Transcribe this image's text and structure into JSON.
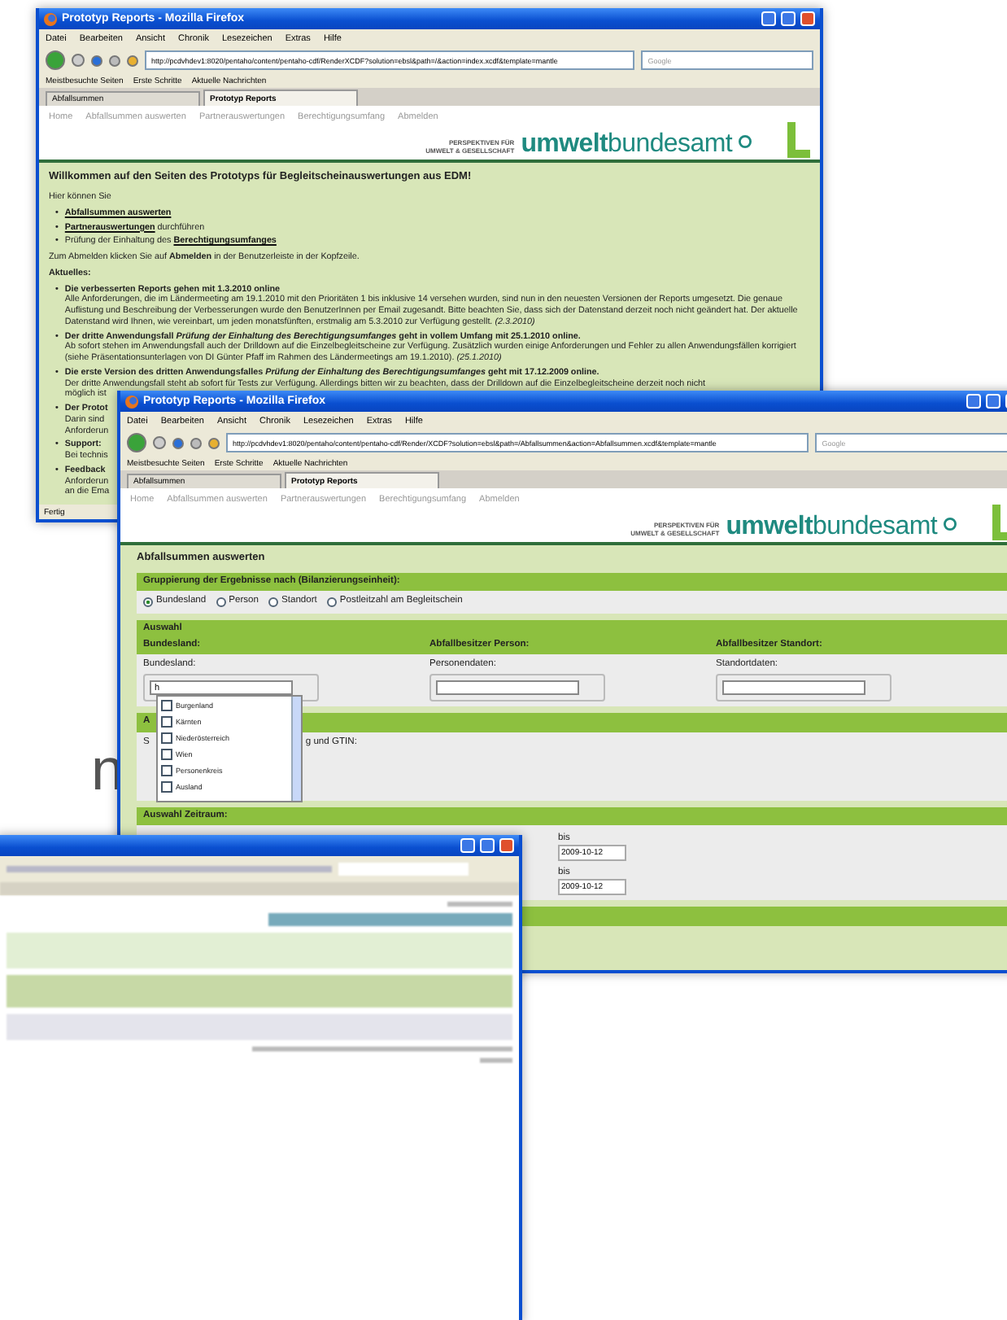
{
  "slide_text": "n",
  "windows": [
    {
      "kind": "welcome",
      "title": "Prototyp Reports - Mozilla Firefox",
      "menu": [
        "Datei",
        "Bearbeiten",
        "Ansicht",
        "Chronik",
        "Lesezeichen",
        "Extras",
        "Hilfe"
      ],
      "url": "http://pcdvhdev1:8020/pentaho/content/pentaho-cdf/RenderXCDF?solution=ebsl&path=/&action=index.xcdf&template=mantle",
      "search_placeholder": "Google",
      "bookmarks": [
        "Meistbesuchte Seiten",
        "Erste Schritte",
        "Aktuelle Nachrichten"
      ],
      "tabs": [
        {
          "label": "Abfallsummen",
          "selected": false
        },
        {
          "label": "Prototyp Reports",
          "selected": true
        }
      ],
      "nav": [
        "Home",
        "Abfallsummen auswerten",
        "Partnerauswertungen",
        "Berechtigungsumfang",
        "Abmelden"
      ],
      "logo": {
        "tagline_1": "PERSPEKTIVEN FÜR",
        "tagline_2": "UMWELT & GESELLSCHAFT",
        "name": "**umwelt**bundesamt"
      },
      "heading": "Willkommen auf den Seiten des Prototyps für Begleitscheinauswertungen aus EDM!",
      "intro": "Hier können Sie",
      "bullet": "•",
      "links": [
        {
          "link": "Abfallsummen auswerten"
        },
        {
          "link": "Partnerauswertungen",
          "rest": " durchführen"
        },
        {
          "link": "Berechtigungsumfanges",
          "before": "Prüfung der Einhaltung des "
        }
      ],
      "logout_hint": "Zum Abmelden klicken Sie auf **Abmelden** in der Benutzerleiste in der Kopfzeile.",
      "news_heading": "Aktuelles:",
      "news": [
        {
          "title": "Die verbesserten Reports gehen mit 1.3.2010 online",
          "body": "Alle Anforderungen, die im Ländermeeting am 19.1.2010 mit den Prioritäten 1 bis inklusive 14 versehen wurden, sind nun in den neuesten Versionen der Reports umgesetzt. Die genaue Auflistung und Beschreibung der Verbesserungen wurde den BenutzerInnen per Email zugesandt. Bitte beachten Sie, dass sich der Datenstand derzeit noch nicht geändert hat. Der aktuelle Datenstand wird Ihnen, wie vereinbart, um jeden monatsfünften, erstmalig am 5.3.2010 zur Verfügung gestellt. *(2.3.2010)*"
        },
        {
          "title": "Der dritte Anwendungsfall *Prüfung der Einhaltung des Berechtigungsumfanges* geht in vollem Umfang mit 25.1.2010 online.",
          "body": "Ab sofort stehen im Anwendungsfall auch der Drilldown auf die Einzelbegleitscheine zur Verfügung. Zusätzlich wurden einige Anforderungen und Fehler zu allen Anwendungsfällen korrigiert (siehe Präsentationsunterlagen von DI Günter Pfaff im Rahmen des Ländermeetings am 19.1.2010). *(25.1.2010)*"
        },
        {
          "title": "Die erste Version des dritten Anwendungsfalles *Prüfung der Einhaltung des Berechtigungsumfanges* geht mit 17.12.2009 online.",
          "body": "Der dritte Anwendungsfall steht ab sofort für Tests zur Verfügung. Allerdings bitten wir zu beachten, dass der Drilldown auf die Einzelbegleitscheine derzeit noch nicht",
          "more": "möglich ist"
        }
      ],
      "fragments": [
        {
          "title": "Der Protot",
          "lines": [
            "Darin sind",
            "Anforderun"
          ]
        },
        {
          "title": "Support:",
          "lines": [
            "Bei technis"
          ]
        },
        {
          "title": "Feedback",
          "lines": [
            "Anforderun",
            "an die Ema"
          ]
        }
      ],
      "status": "Fertig"
    },
    {
      "kind": "form",
      "title": "Prototyp Reports - Mozilla Firefox",
      "menu": [
        "Datei",
        "Bearbeiten",
        "Ansicht",
        "Chronik",
        "Lesezeichen",
        "Extras",
        "Hilfe"
      ],
      "url": "http://pcdvhdev1:8020/pentaho/content/pentaho-cdf/Render/XCDF?solution=ebsl&path=/Abfallsummen&action=Abfallsummen.xcdf&template=mantle",
      "search_placeholder": "Google",
      "bookmarks": [
        "Meistbesuchte Seiten",
        "Erste Schritte",
        "Aktuelle Nachrichten"
      ],
      "tabs": [
        {
          "label": "Abfallsummen",
          "selected": false
        },
        {
          "label": "Prototyp Reports",
          "selected": true
        }
      ],
      "nav": [
        "Home",
        "Abfallsummen auswerten",
        "Partnerauswertungen",
        "Berechtigungsumfang",
        "Abmelden"
      ],
      "logo": {
        "tagline_1": "PERSPEKTIVEN FÜR",
        "tagline_2": "UMWELT & GESELLSCHAFT",
        "name": "**umwelt**bundesamt"
      },
      "page_title": "Abfallsummen auswerten",
      "grouping": {
        "title": "Gruppierung der Ergebnisse nach (Bilanzierungseinheit):",
        "options": [
          {
            "label": "Bundesland",
            "selected": true
          },
          {
            "label": "Person",
            "selected": false
          },
          {
            "label": "Standort",
            "selected": false
          },
          {
            "label": "Postleitzahl am Begleitschein",
            "selected": false
          }
        ]
      },
      "selection": {
        "title": "Auswahl",
        "columns": [
          {
            "heading": "Bundesland:",
            "label": "Bundesland:",
            "value": "h"
          },
          {
            "heading": "Abfallbesitzer Person:",
            "label": "Personendaten:"
          },
          {
            "heading": "Abfallbesitzer Standort:",
            "label": "Standortdaten:"
          }
        ]
      },
      "dropdown": [
        {
          "label": "Burgenland",
          "checked": false
        },
        {
          "label": "Kärnten",
          "checked": false
        },
        {
          "label": "Niederösterreich",
          "checked": false
        },
        {
          "label": "Wien",
          "checked": false
        },
        {
          "label": "Personenkreis",
          "checked": false
        },
        {
          "label": "Ausland",
          "checked": false
        }
      ],
      "section_2": {
        "title": "A",
        "label_start": "S",
        "label_end": "g und GTIN:"
      },
      "period": {
        "title": "Auswahl Zeitraum:",
        "rows": [
          {
            "label": "bis",
            "value": "2009-10-12"
          },
          {
            "label": "bis",
            "value": "2009-10-12"
          }
        ]
      }
    },
    {
      "kind": "report"
    }
  ]
}
